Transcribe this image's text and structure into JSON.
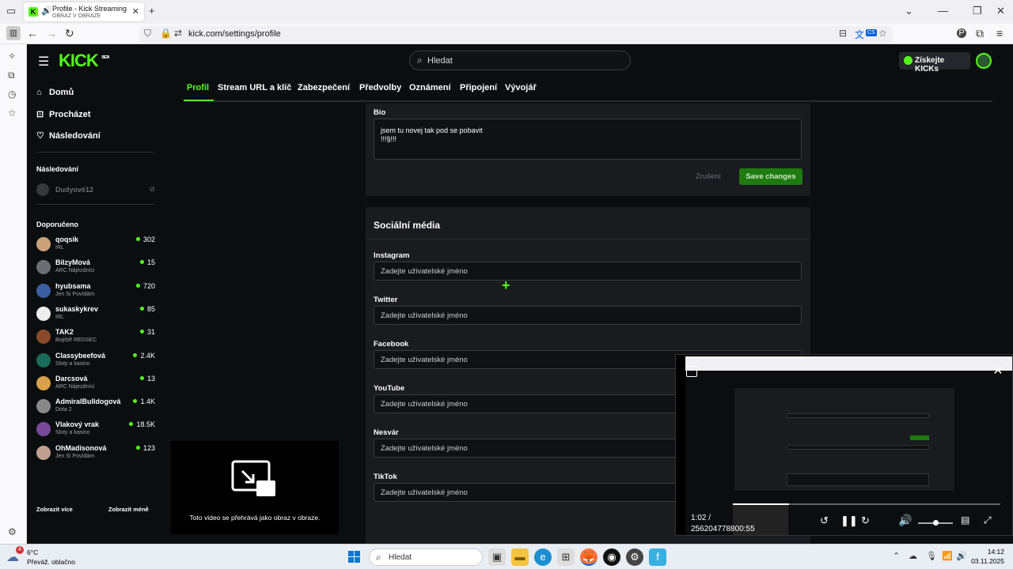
{
  "browser": {
    "tab_title": "Profile - Kick Streaming",
    "tab_subtitle": "OBRAZ V OBRAZE",
    "url": "kick.com/settings/profile",
    "translate_badge": "CS"
  },
  "header": {
    "logo": "KICK",
    "logo_beta": "BETA",
    "search_placeholder": "Hledat",
    "get_kicks_label": "Získejte KICKs"
  },
  "leftnav": {
    "items": [
      {
        "label": "Domů",
        "icon": "home-icon"
      },
      {
        "label": "Procházet",
        "icon": "browse-icon"
      },
      {
        "label": "Následování",
        "icon": "heart-icon"
      }
    ],
    "following_title": "Následování",
    "followed_channel": "Dudyové12",
    "recommended_title": "Doporučeno",
    "channels": [
      {
        "name": "qoqsik",
        "category": "IRL",
        "viewers": "302",
        "color": "#c9a27a"
      },
      {
        "name": "BilzyMová",
        "category": "ARC Nájezdníci",
        "viewers": "15",
        "color": "#6b6f73"
      },
      {
        "name": "hyubsama",
        "category": "Jen Si Povídám",
        "viewers": "720",
        "color": "#3a5fa0"
      },
      {
        "name": "sukaskykrev",
        "category": "IRL",
        "viewers": "85",
        "color": "#eeeeee"
      },
      {
        "name": "TAK2",
        "category": "Bojiště REDSEC",
        "viewers": "31",
        "color": "#8a4a2a"
      },
      {
        "name": "Classybeefová",
        "category": "Sloty a kasino",
        "viewers": "2.4K",
        "color": "#1b6b5a"
      },
      {
        "name": "Darcsová",
        "category": "ARC Nájezdníci",
        "viewers": "13",
        "color": "#d9a24a"
      },
      {
        "name": "AdmiralBulldogová",
        "category": "Dota 2",
        "viewers": "1.4K",
        "color": "#888888"
      },
      {
        "name": "Vlakový vrak",
        "category": "Sloty a kasino",
        "viewers": "18.5K",
        "color": "#7a4a9a"
      },
      {
        "name": "OhMadisonová",
        "category": "Jen Si Povídám",
        "viewers": "123",
        "color": "#c0a090"
      }
    ],
    "show_more": "Zobrazit více",
    "show_less": "Zobrazit méně"
  },
  "settings_tabs": [
    "Profil",
    "Stream URL a klíč",
    "Zabezpečení",
    "Předvolby",
    "Oznámení",
    "Připojení",
    "Vývojář"
  ],
  "bio": {
    "label": "Bio",
    "line1": "jsem tu novej tak pod se pobavit",
    "line2": "!!!§!!!",
    "cancel": "Zrušeni",
    "save": "Save changes"
  },
  "social": {
    "title": "Sociální média",
    "placeholder": "Zadejte uživatelské jméno",
    "fields": [
      "Instagram",
      "Twitter",
      "Facebook",
      "YouTube",
      "Nesvár",
      "TikTok"
    ]
  },
  "pip_placeholder": {
    "message": "Toto video se přehrává jako obraz v obraze."
  },
  "pip": {
    "time_current": "1:02 /",
    "time_total": "256204778800:55",
    "progress": 0.21,
    "volume": 0.5
  },
  "taskbar": {
    "notif_count": "4",
    "temp": "6°C",
    "weather": "Převáž. oblačno",
    "search": "Hledat",
    "time": "14:12",
    "date": "03.11.2025"
  }
}
